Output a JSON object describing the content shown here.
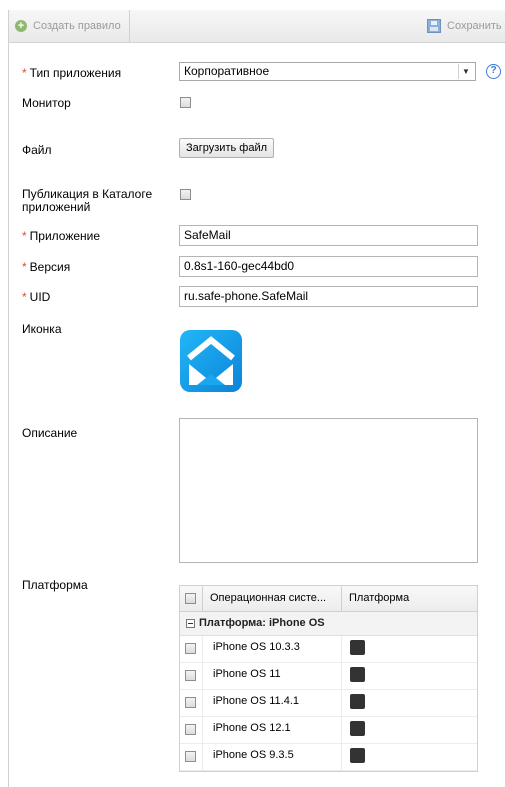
{
  "toolbar": {
    "create_label": "Создать правило",
    "save_label": "Сохранить"
  },
  "form": {
    "app_type": {
      "label": "Тип приложения",
      "value": "Корпоративное"
    },
    "monitor": {
      "label": "Монитор",
      "checked": false
    },
    "file": {
      "label": "Файл",
      "button": "Загрузить файл"
    },
    "catalog": {
      "label_line1": "Публикация в Каталоге",
      "label_line2": "приложений",
      "checked": false
    },
    "application": {
      "label": "Приложение",
      "value": "SafeMail"
    },
    "version": {
      "label": "Версия",
      "value": "0.8s1-160-gec44bd0"
    },
    "uid": {
      "label": "UID",
      "value": "ru.safe-phone.SafeMail"
    },
    "icon": {
      "label": "Иконка",
      "icon": "safemail-app-icon"
    },
    "description": {
      "label": "Описание",
      "value": ""
    },
    "platform": {
      "label": "Платформа"
    }
  },
  "required_mark": "*",
  "platform_grid": {
    "columns": [
      "Операционная систе...",
      "Платформа"
    ],
    "group_label": "Платформа: iPhone OS",
    "rows": [
      {
        "os": "iPhone OS 10.3.3",
        "platform_icon": "apple-icon"
      },
      {
        "os": "iPhone OS 11",
        "platform_icon": "apple-icon"
      },
      {
        "os": "iPhone OS 11.4.1",
        "platform_icon": "apple-icon"
      },
      {
        "os": "iPhone OS 12.1",
        "platform_icon": "apple-icon"
      },
      {
        "os": "iPhone OS 9.3.5",
        "platform_icon": "apple-icon"
      }
    ]
  },
  "colors": {
    "required": "#d9532a",
    "help": "#3a7bd5",
    "app_icon": "#1aa7ef"
  }
}
